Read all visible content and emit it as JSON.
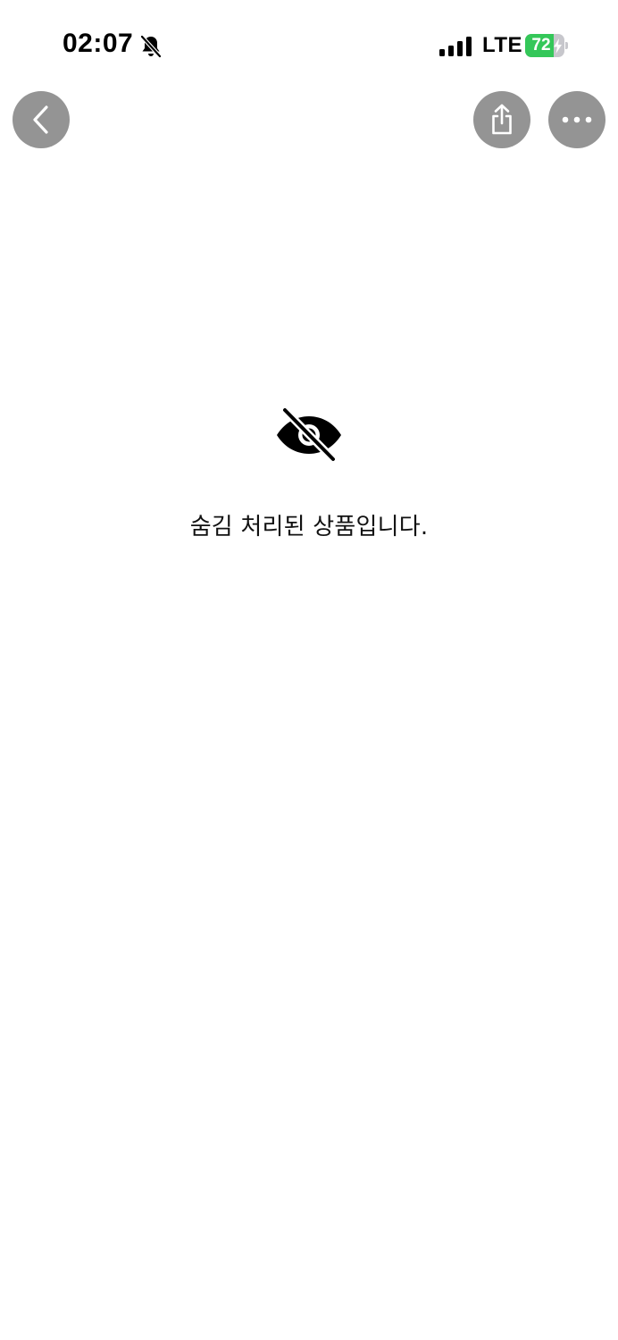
{
  "status_bar": {
    "time": "02:07",
    "network": "LTE",
    "battery_level": "72",
    "battery_fraction": 0.72,
    "battery_color": "#34c759",
    "silent_icon": "bell-slash-icon",
    "signal_icon": "cellular-signal-icon",
    "charging_icon": "bolt-icon"
  },
  "nav": {
    "back_icon": "chevron-left-icon",
    "share_icon": "share-icon",
    "more_icon": "ellipsis-icon",
    "button_color": "#949494"
  },
  "notice": {
    "icon": "eye-slash-icon",
    "message": "숨김 처리된 상품입니다."
  }
}
